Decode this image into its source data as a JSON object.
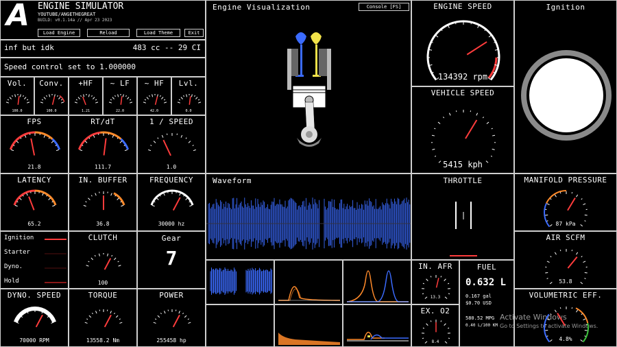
{
  "header": {
    "logo": "A",
    "app_title": "ENGINE SIMULATOR",
    "channel": "YOUTUBE/ANGETHEGREAT",
    "build": "BUILD: v0.1.14a // Apr 23 2023",
    "buttons": {
      "load_engine": "Load Engine",
      "reload": "Reload",
      "load_theme": "Load Theme",
      "exit": "Exit"
    }
  },
  "engine_info": {
    "name": "inf but idk",
    "displacement": "483 cc -- 29 CI"
  },
  "speed_control": "Speed control set to 1.000000",
  "small_gauges": [
    {
      "label": "Vol.",
      "value": "100.0"
    },
    {
      "label": "Conv.",
      "value": "100.0"
    },
    {
      "label": "+HF",
      "value": "1.21"
    },
    {
      "label": "~ LF",
      "value": "22.0"
    },
    {
      "label": "~ HF",
      "value": "42.0"
    },
    {
      "label": "Lvl.",
      "value": "0.0"
    }
  ],
  "perf_gauges": [
    {
      "label": "FPS",
      "value": "21.8"
    },
    {
      "label": "RT/dT",
      "value": "111.7"
    },
    {
      "label": "1 / SPEED",
      "value": "1.0"
    }
  ],
  "audio_gauges": [
    {
      "label": "LATENCY",
      "value": "65.2"
    },
    {
      "label": "IN. BUFFER",
      "value": "36.8"
    },
    {
      "label": "FREQUENCY",
      "value": "30000 hz"
    }
  ],
  "toggles": [
    {
      "label": "Ignition",
      "on": true
    },
    {
      "label": "Starter",
      "on": false
    },
    {
      "label": "Dyno.",
      "on": false
    },
    {
      "label": "Hold",
      "on": true
    }
  ],
  "clutch": {
    "label": "CLUTCH",
    "value": "100"
  },
  "gear": {
    "label": "Gear",
    "value": "7"
  },
  "dyno_speed": {
    "label": "DYNO. SPEED",
    "value": "70000 RPM"
  },
  "torque": {
    "label": "TORQUE",
    "value": "13558.2 Nm"
  },
  "power": {
    "label": "POWER",
    "value": "255458 hp"
  },
  "engine_viz": {
    "title": "Engine Visualization",
    "console_btn": "Console [FS]"
  },
  "waveform": {
    "title": "Waveform"
  },
  "engine_speed": {
    "label": "ENGINE SPEED",
    "value": "134392 rpm"
  },
  "vehicle_speed": {
    "label": "VEHICLE SPEED",
    "value": "5415 kph"
  },
  "ignition_panel": {
    "label": "Ignition"
  },
  "throttle": {
    "label": "THROTTLE"
  },
  "manifold": {
    "label": "MANIFOLD PRESSURE",
    "value": "87 kPa"
  },
  "air_scfm": {
    "label": "AIR SCFM",
    "value": "53.8"
  },
  "vol_eff": {
    "label": "VOLUMETRIC EFF.",
    "value": "4.8%"
  },
  "in_afr": {
    "label": "IN. AFR",
    "value": "13.3"
  },
  "ex_o2": {
    "label": "EX. O2",
    "value": "8.4"
  },
  "fuel": {
    "label": "FUEL",
    "value": "0.632 L",
    "gal": "0.167 gal",
    "usd": "$0.70 USD",
    "mpg": "580.52 MPG",
    "lkm": "0.40 L/100 KM"
  },
  "watermark": {
    "line1": "Activate Windows",
    "line2": "Go to Settings to activate Windows."
  },
  "colors": {
    "red": "#ff3c3c",
    "blue": "#3b6bff",
    "orange": "#ff8a2a",
    "yellow": "#f2e24a",
    "border": "#cfcfcf"
  }
}
